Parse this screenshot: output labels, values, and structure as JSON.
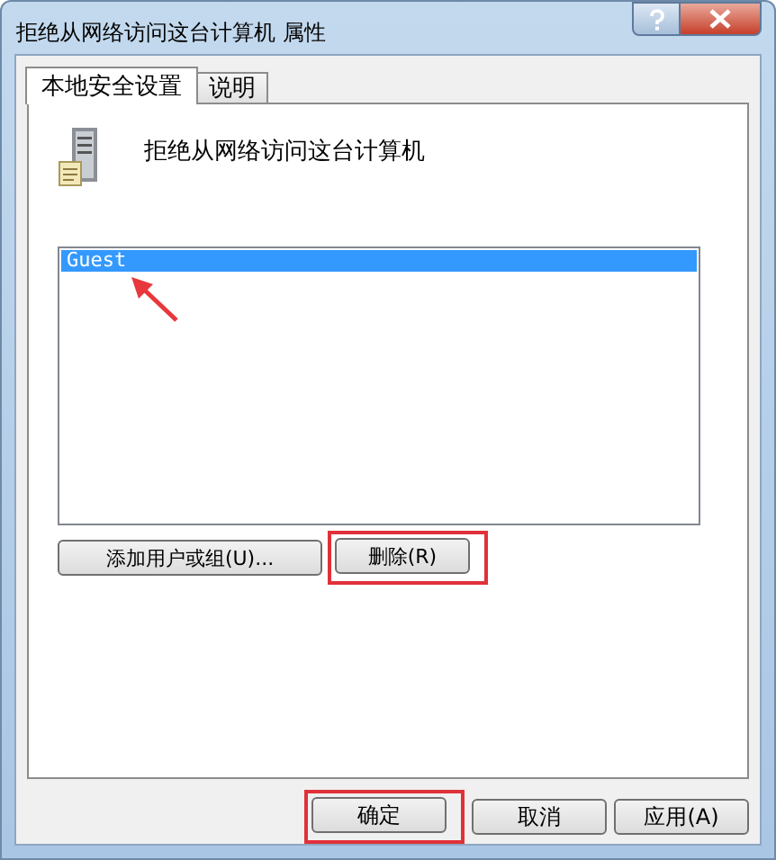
{
  "window": {
    "title": "拒绝从网络访问这台计算机 属性"
  },
  "tabs": [
    {
      "label": "本地安全设置",
      "selected": true
    },
    {
      "label": "说明",
      "selected": false
    }
  ],
  "policy": {
    "title": "拒绝从网络访问这台计算机"
  },
  "accounts": [
    {
      "name": "Guest",
      "selected": true,
      "arrow": true
    }
  ],
  "list_buttons": [
    {
      "label": "添加用户或组(U)...",
      "highlighted": false
    },
    {
      "label": "删除(R)",
      "highlighted": true
    }
  ],
  "dialog_buttons": [
    {
      "label": "确定",
      "highlighted": true
    },
    {
      "label": "取消",
      "highlighted": false
    },
    {
      "label": "应用(A)",
      "highlighted": false
    }
  ]
}
